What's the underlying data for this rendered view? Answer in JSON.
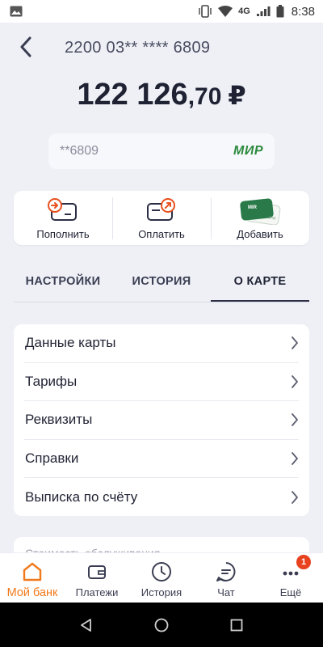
{
  "status_bar": {
    "network": "4G",
    "time": "8:38"
  },
  "header": {
    "card_number": "2200 03** **** 6809"
  },
  "balance": {
    "integer": "122 126",
    "fraction": ",70",
    "currency": "₽"
  },
  "card_pill": {
    "masked": "**6809",
    "payment_system": "МИР"
  },
  "actions": [
    {
      "label": "Пополнить",
      "icon": "card-topup-icon"
    },
    {
      "label": "Оплатить",
      "icon": "card-pay-icon"
    },
    {
      "label": "Добавить",
      "icon": "mir-pay-icon",
      "badge_text": "MIR",
      "sub_text": "Pay"
    }
  ],
  "tabs": [
    {
      "label": "НАСТРОЙКИ",
      "active": false
    },
    {
      "label": "ИСТОРИЯ",
      "active": false
    },
    {
      "label": "О КАРТЕ",
      "active": true
    }
  ],
  "menu": [
    {
      "label": "Данные карты"
    },
    {
      "label": "Тарифы"
    },
    {
      "label": "Реквизиты"
    },
    {
      "label": "Справки"
    },
    {
      "label": "Выписка по счёту"
    }
  ],
  "next_section": {
    "peek_text": "Стоимость обслуживания"
  },
  "bottom_nav": [
    {
      "label": "Мой банк",
      "icon": "home-icon",
      "active": true
    },
    {
      "label": "Платежи",
      "icon": "wallet-icon",
      "active": false
    },
    {
      "label": "История",
      "icon": "clock-icon",
      "active": false
    },
    {
      "label": "Чат",
      "icon": "chat-icon",
      "active": false
    },
    {
      "label": "Ещё",
      "icon": "more-icon",
      "active": false,
      "badge": "1"
    }
  ],
  "colors": {
    "accent": "#f07a1a",
    "background": "#eef0f6",
    "text": "#1f2233",
    "badge": "#e8421f",
    "mir_green": "#2d8a3e"
  }
}
